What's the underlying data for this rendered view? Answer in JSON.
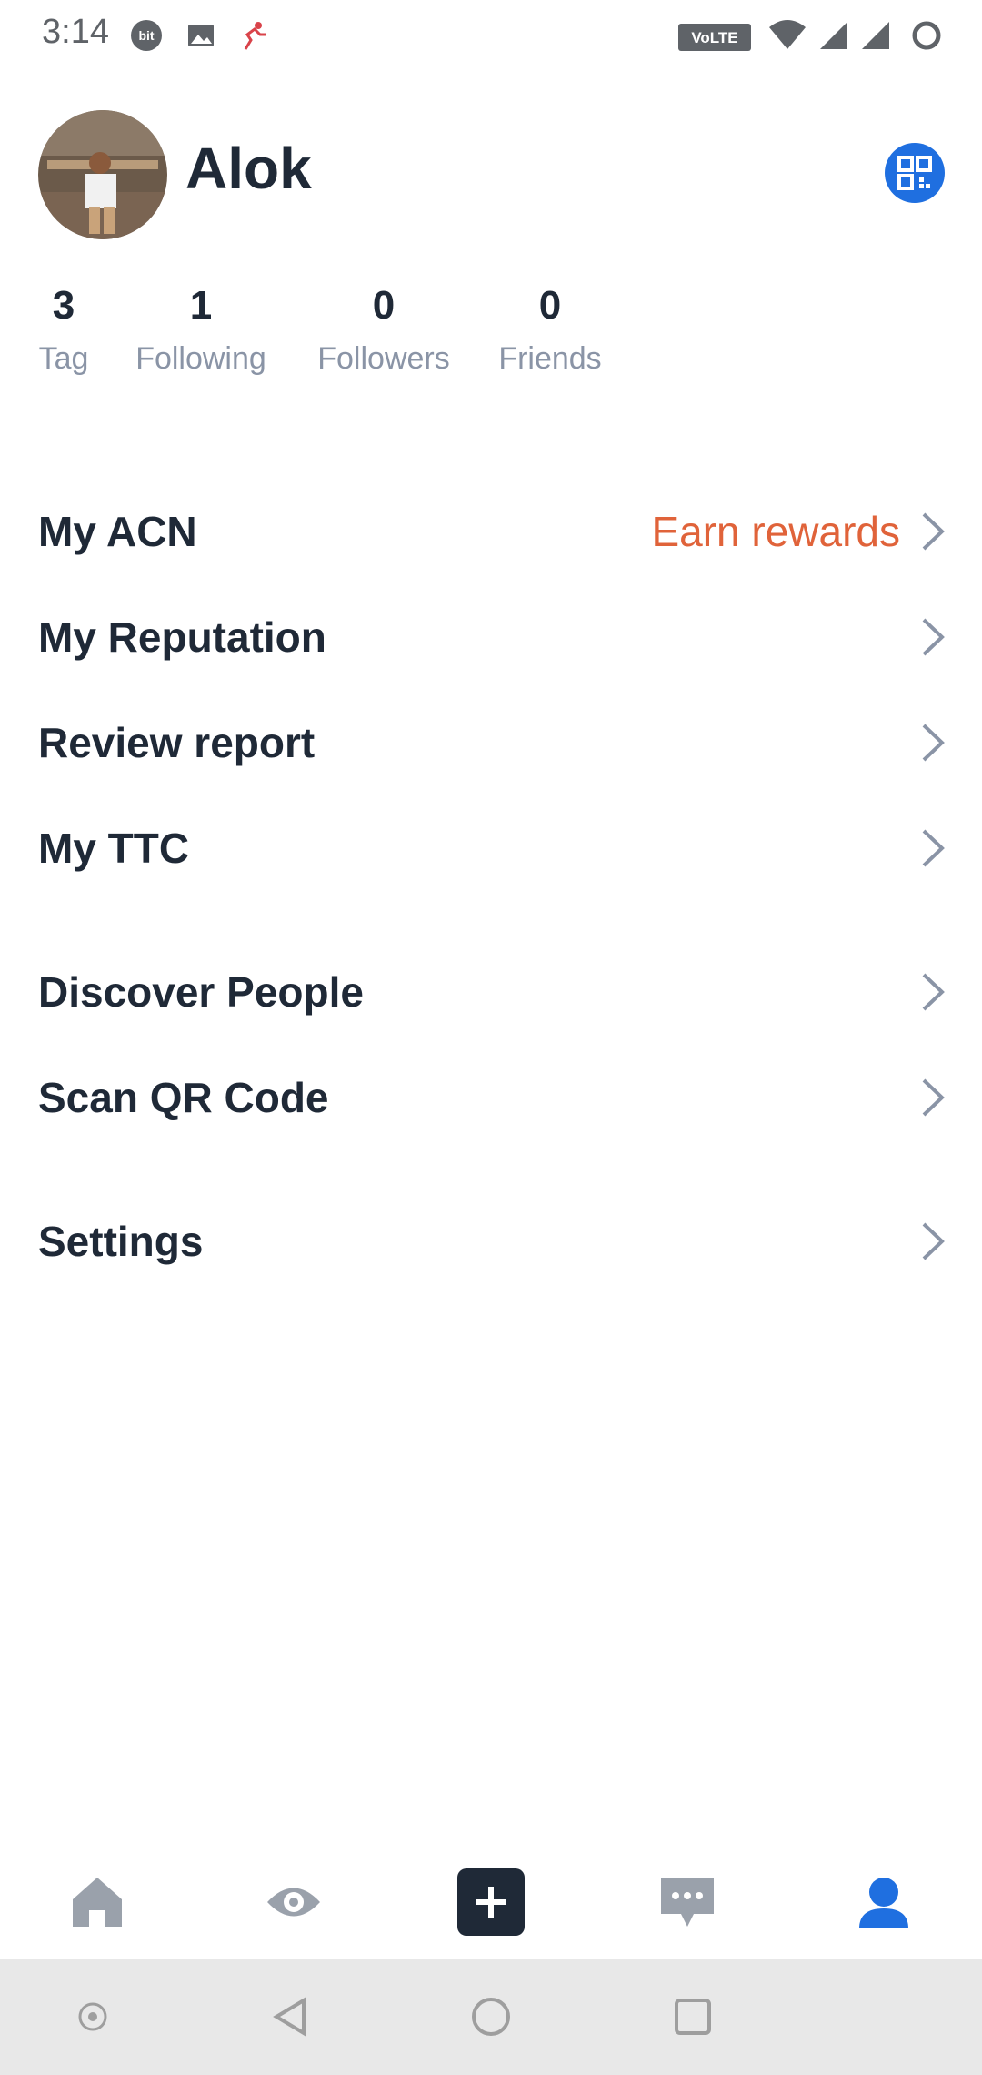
{
  "status_bar": {
    "time": "3:14",
    "volte_label": "VoLTE"
  },
  "profile": {
    "name": "Alok"
  },
  "stats": [
    {
      "value": "3",
      "label": "Tag"
    },
    {
      "value": "1",
      "label": "Following"
    },
    {
      "value": "0",
      "label": "Followers"
    },
    {
      "value": "0",
      "label": "Friends"
    }
  ],
  "menu": {
    "my_acn": "My ACN",
    "earn_rewards": "Earn rewards",
    "my_reputation": "My Reputation",
    "review_report": "Review report",
    "my_ttc": "My TTC",
    "discover_people": "Discover People",
    "scan_qr_code": "Scan QR Code",
    "settings": "Settings"
  },
  "colors": {
    "accent_blue": "#1f6fe0",
    "reward_orange": "#e0633a",
    "text_dark": "#1f2937",
    "text_muted": "#8a94a6",
    "icon_gray": "#9aa1ab",
    "system_nav_bg": "#e8e8e8"
  },
  "icons": {
    "status": [
      "bit-icon",
      "gallery-icon",
      "runner-icon",
      "volte-icon",
      "wifi-icon",
      "signal-icon",
      "signal-icon",
      "loading-icon"
    ],
    "bottom_nav": [
      "home-icon",
      "eye-icon",
      "plus-icon",
      "chat-icon",
      "profile-icon"
    ],
    "system_nav": [
      "recent-dot-icon",
      "back-icon",
      "home-circle-icon",
      "overview-icon"
    ]
  }
}
